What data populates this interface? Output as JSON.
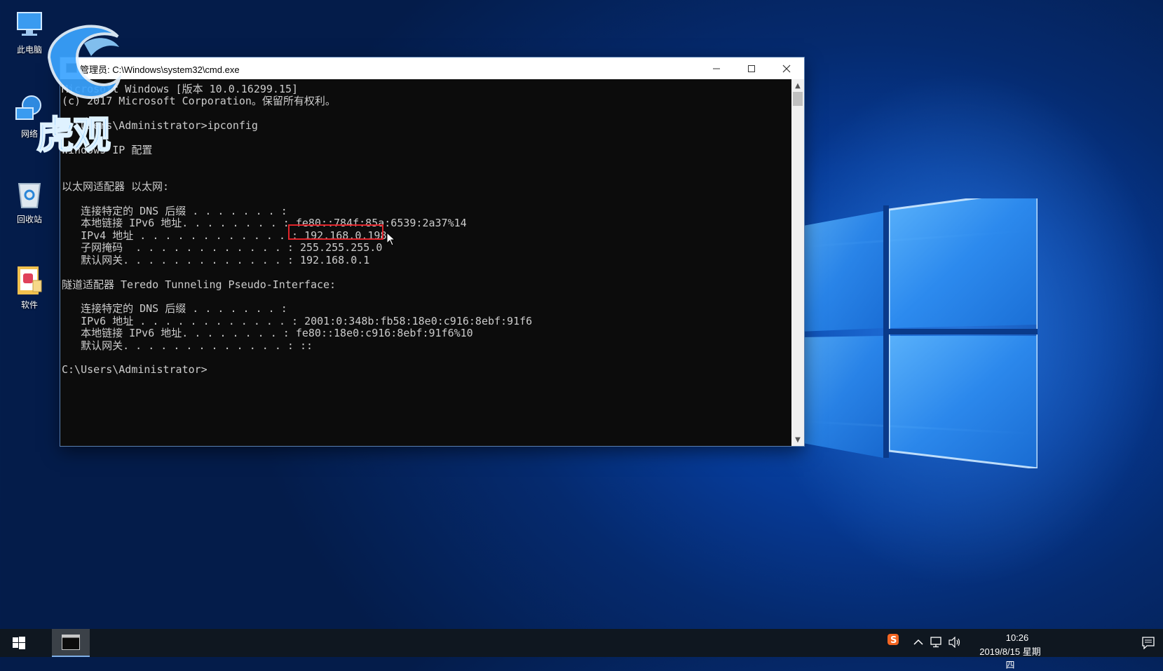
{
  "desktop": {
    "icons": [
      {
        "label": "此电脑",
        "icon": "computer-icon"
      },
      {
        "label": "网络",
        "icon": "network-icon"
      },
      {
        "label": "回收站",
        "icon": "recycle-bin-icon"
      },
      {
        "label": "软件",
        "icon": "folder-icon"
      }
    ],
    "watermark": "虎观"
  },
  "cmd": {
    "title": "管理员: C:\\Windows\\system32\\cmd.exe",
    "lines": [
      "Microsoft Windows [版本 10.0.16299.15]",
      "(c) 2017 Microsoft Corporation。保留所有权利。",
      "",
      "C:\\Users\\Administrator>ipconfig",
      "",
      "Windows IP 配置",
      "",
      "",
      "以太网适配器 以太网:",
      "",
      "   连接特定的 DNS 后缀 . . . . . . . :",
      "   本地链接 IPv6 地址. . . . . . . . : fe80::784f:85a:6539:2a37%14",
      "   IPv4 地址 . . . . . . . . . . . . : 192.168.0.198",
      "   子网掩码  . . . . . . . . . . . . : 255.255.255.0",
      "   默认网关. . . . . . . . . . . . . : 192.168.0.1",
      "",
      "隧道适配器 Teredo Tunneling Pseudo-Interface:",
      "",
      "   连接特定的 DNS 后缀 . . . . . . . :",
      "   IPv6 地址 . . . . . . . . . . . . : 2001:0:348b:fb58:18e0:c916:8ebf:91f6",
      "   本地链接 IPv6 地址. . . . . . . . : fe80::18e0:c916:8ebf:91f6%10",
      "   默认网关. . . . . . . . . . . . . : ::",
      "",
      "C:\\Users\\Administrator>"
    ],
    "highlighted_value": "192.168.0.198"
  },
  "taskbar": {
    "time": "10:26",
    "date": "2019/8/15 星期四"
  },
  "colors": {
    "highlight": "#e0242a",
    "console_bg": "#0c0c0c",
    "console_fg": "#cccccc"
  }
}
